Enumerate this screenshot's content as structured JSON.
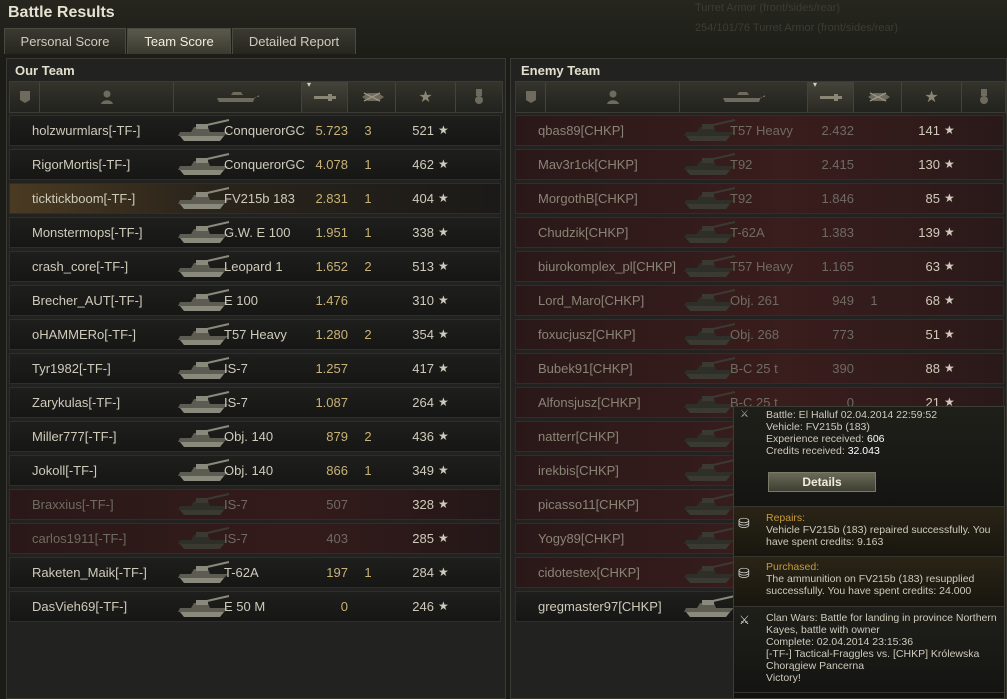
{
  "window": {
    "title": "Battle Results"
  },
  "background_text": [
    "Turret Armor (front/sides/rear)",
    "254/101/76  Turret Armor (front/sides/rear)"
  ],
  "tabs": [
    {
      "label": "Personal Score",
      "active": false
    },
    {
      "label": "Team Score",
      "active": true
    },
    {
      "label": "Detailed Report",
      "active": false
    }
  ],
  "our_team": {
    "title": "Our Team",
    "rows": [
      {
        "player": "holzwurmlars[-TF-]",
        "tank": "ConquerorGC",
        "damage": "5.723",
        "kills": "3",
        "xp": "521",
        "state": "alive"
      },
      {
        "player": "RigorMortis[-TF-]",
        "tank": "ConquerorGC",
        "damage": "4.078",
        "kills": "1",
        "xp": "462",
        "state": "alive"
      },
      {
        "player": "ticktickboom[-TF-]",
        "tank": "FV215b 183",
        "damage": "2.831",
        "kills": "1",
        "xp": "404",
        "state": "self"
      },
      {
        "player": "Monstermops[-TF-]",
        "tank": "G.W. E 100",
        "damage": "1.951",
        "kills": "1",
        "xp": "338",
        "state": "alive"
      },
      {
        "player": "crash_core[-TF-]",
        "tank": "Leopard 1",
        "damage": "1.652",
        "kills": "2",
        "xp": "513",
        "state": "alive"
      },
      {
        "player": "Brecher_AUT[-TF-]",
        "tank": "E 100",
        "damage": "1.476",
        "kills": "",
        "xp": "310",
        "state": "alive"
      },
      {
        "player": "oHAMMERo[-TF-]",
        "tank": "T57 Heavy",
        "damage": "1.280",
        "kills": "2",
        "xp": "354",
        "state": "alive"
      },
      {
        "player": "Tyr1982[-TF-]",
        "tank": "IS-7",
        "damage": "1.257",
        "kills": "",
        "xp": "417",
        "state": "alive"
      },
      {
        "player": "Zarykulas[-TF-]",
        "tank": "IS-7",
        "damage": "1.087",
        "kills": "",
        "xp": "264",
        "state": "alive"
      },
      {
        "player": "Miller777[-TF-]",
        "tank": "Obj. 140",
        "damage": "879",
        "kills": "2",
        "xp": "436",
        "state": "alive"
      },
      {
        "player": "Jokoll[-TF-]",
        "tank": "Obj. 140",
        "damage": "866",
        "kills": "1",
        "xp": "349",
        "state": "alive"
      },
      {
        "player": "Braxxius[-TF-]",
        "tank": "IS-7",
        "damage": "507",
        "kills": "",
        "xp": "328",
        "state": "dead"
      },
      {
        "player": "carlos1911[-TF-]",
        "tank": "IS-7",
        "damage": "403",
        "kills": "",
        "xp": "285",
        "state": "dead"
      },
      {
        "player": "Raketen_Maik[-TF-]",
        "tank": "T-62A",
        "damage": "197",
        "kills": "1",
        "xp": "284",
        "state": "alive"
      },
      {
        "player": "DasVieh69[-TF-]",
        "tank": "E 50 M",
        "damage": "0",
        "kills": "",
        "xp": "246",
        "state": "alive"
      }
    ]
  },
  "enemy_team": {
    "title": "Enemy Team",
    "rows": [
      {
        "player": "qbas89[CHKP]",
        "tank": "T57 Heavy",
        "damage": "2.432",
        "kills": "",
        "xp": "141",
        "state": "dead"
      },
      {
        "player": "Mav3r1ck[CHKP]",
        "tank": "T92",
        "damage": "2.415",
        "kills": "",
        "xp": "130",
        "state": "dead"
      },
      {
        "player": "MorgothB[CHKP]",
        "tank": "T92",
        "damage": "1.846",
        "kills": "",
        "xp": "85",
        "state": "dead"
      },
      {
        "player": "Chudzik[CHKP]",
        "tank": "T-62A",
        "damage": "1.383",
        "kills": "",
        "xp": "139",
        "state": "dead"
      },
      {
        "player": "biurokomplex_pl[CHKP]",
        "tank": "T57 Heavy",
        "damage": "1.165",
        "kills": "",
        "xp": "63",
        "state": "dead"
      },
      {
        "player": "Lord_Maro[CHKP]",
        "tank": "Obj. 261",
        "damage": "949",
        "kills": "1",
        "xp": "68",
        "state": "dead"
      },
      {
        "player": "foxucjusz[CHKP]",
        "tank": "Obj. 268",
        "damage": "773",
        "kills": "",
        "xp": "51",
        "state": "dead"
      },
      {
        "player": "Bubek91[CHKP]",
        "tank": "B-C 25 t",
        "damage": "390",
        "kills": "",
        "xp": "88",
        "state": "dead"
      },
      {
        "player": "Alfonsjusz[CHKP]",
        "tank": "B-C 25 t",
        "damage": "0",
        "kills": "",
        "xp": "21",
        "state": "dead"
      },
      {
        "player": "natterr[CHKP]",
        "tank": "",
        "damage": "",
        "kills": "",
        "xp": "",
        "state": "dead"
      },
      {
        "player": "irekbis[CHKP]",
        "tank": "",
        "damage": "",
        "kills": "",
        "xp": "",
        "state": "dead"
      },
      {
        "player": "picasso11[CHKP]",
        "tank": "",
        "damage": "",
        "kills": "",
        "xp": "",
        "state": "dead"
      },
      {
        "player": "Yogy89[CHKP]",
        "tank": "",
        "damage": "",
        "kills": "",
        "xp": "",
        "state": "dead"
      },
      {
        "player": "cidotestex[CHKP]",
        "tank": "",
        "damage": "",
        "kills": "",
        "xp": "",
        "state": "dead"
      },
      {
        "player": "gregmaster97[CHKP]",
        "tank": "",
        "damage": "",
        "kills": "",
        "xp": "",
        "state": "alive"
      }
    ]
  },
  "popup": {
    "battle": "Battle: El Halluf 02.04.2014 22:59:52",
    "vehicle": "Vehicle: FV215b (183)",
    "xp_label": "Experience received:",
    "xp_value": "606",
    "credits_label": "Credits received:",
    "credits_value": "32.043",
    "details_button": "Details",
    "repairs_label": "Repairs:",
    "repairs_line1": "Vehicle FV215b (183) repaired successfully. You",
    "repairs_line2": "have spent credits:  9.163",
    "purchased_label": "Purchased:",
    "purchased_line1": "The ammunition on FV215b (183) resupplied",
    "purchased_line2": "successfully. You have spent credits:  24.000",
    "cw_line1": "Clan Wars: Battle for landing in province Northern",
    "cw_line2": "Kayes, battle with owner",
    "cw_line3": "Complete: 02.04.2014 23:15:36",
    "cw_line4": "[-TF-] Tactical-Fraggles vs. [CHKP] Królewska",
    "cw_line5": "Chorągiew Pancerna",
    "cw_line6": "Victory!"
  },
  "colors": {
    "damage": "#c9b277",
    "orange_label": "#c89a3b",
    "dead_row": "#341b1b",
    "highlight_row": "#4a3a22"
  },
  "icons": {
    "star": "★"
  }
}
